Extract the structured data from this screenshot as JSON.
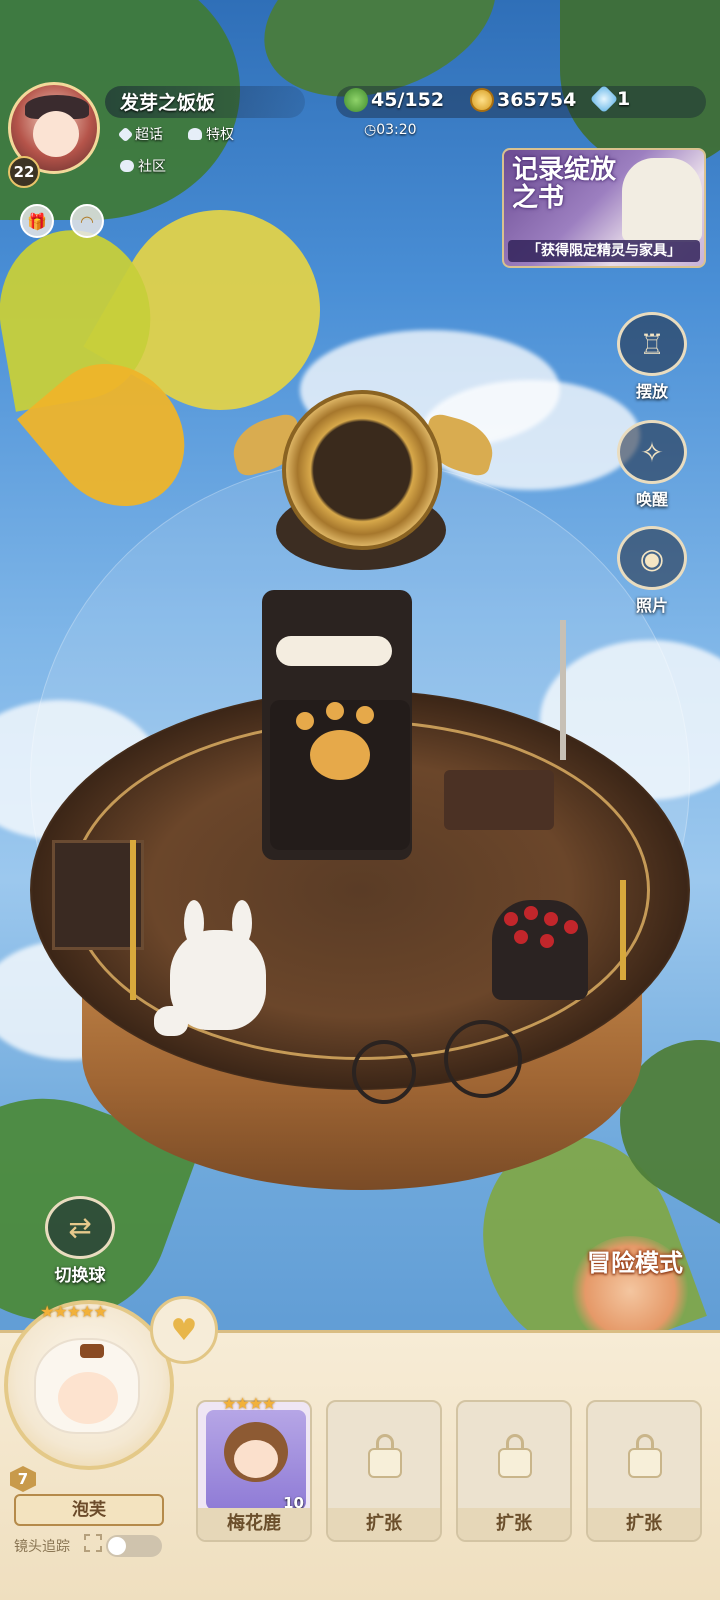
{
  "player": {
    "name": "发芽之饭饭",
    "level": "22",
    "links": {
      "chat": "超话",
      "privilege": "特权",
      "community": "社区"
    }
  },
  "resources": {
    "clover": "45/152",
    "timer": "03:20",
    "gold": "365754",
    "gem": "1"
  },
  "banner": {
    "title": "记录绽放之书",
    "subtitle": "「获得限定精灵与家具」"
  },
  "side_buttons": {
    "place": "摆放",
    "awaken": "唤醒",
    "photo": "照片"
  },
  "switch_ball": "切换球",
  "adventure_mode": "冒险模式",
  "main_character": {
    "name": "泡芙",
    "level": "7",
    "stars": "★★★★★",
    "camera_tracking_label": "镜头追踪",
    "camera_tracking_on": false
  },
  "slots": [
    {
      "label": "梅花鹿",
      "level": "10",
      "stars": "★★★★",
      "locked": false
    },
    {
      "label": "扩张",
      "locked": true
    },
    {
      "label": "扩张",
      "locked": true
    },
    {
      "label": "扩张",
      "locked": true
    }
  ],
  "colors": {
    "accent_gold": "#e9c46a",
    "panel_bg": "#f7ecd6",
    "adventure_glow": "#e59968"
  }
}
